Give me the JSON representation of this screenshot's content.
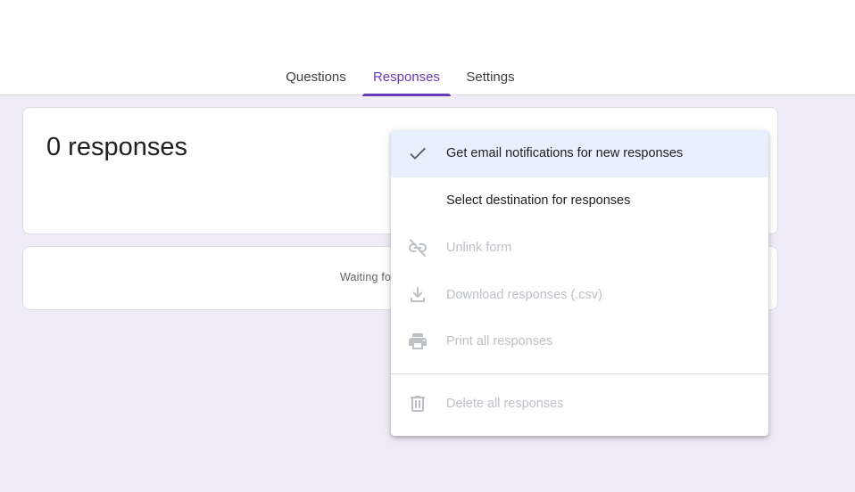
{
  "tabs": [
    {
      "label": "Questions"
    },
    {
      "label": "Responses"
    },
    {
      "label": "Settings"
    }
  ],
  "active_tab": "Responses",
  "summary": {
    "count_label": "0 responses"
  },
  "waiting": {
    "text": "Waiting fo"
  },
  "menu": {
    "items": [
      {
        "label": "Get email notifications for new responses",
        "icon": "check-icon",
        "enabled": true,
        "checked": true
      },
      {
        "label": "Select destination for responses",
        "icon": "",
        "enabled": true
      },
      {
        "label": "Unlink form",
        "icon": "link-off-icon",
        "enabled": false
      },
      {
        "label": "Download responses (.csv)",
        "icon": "download-icon",
        "enabled": false
      },
      {
        "label": "Print all responses",
        "icon": "print-icon",
        "enabled": false
      },
      {
        "label": "Delete all responses",
        "icon": "trash-icon",
        "enabled": false
      }
    ]
  },
  "colors": {
    "accent": "#673ab7",
    "page_background": "#f0ebf8",
    "highlight": "#e8f0fe",
    "disabled": "#bdc1c6"
  }
}
